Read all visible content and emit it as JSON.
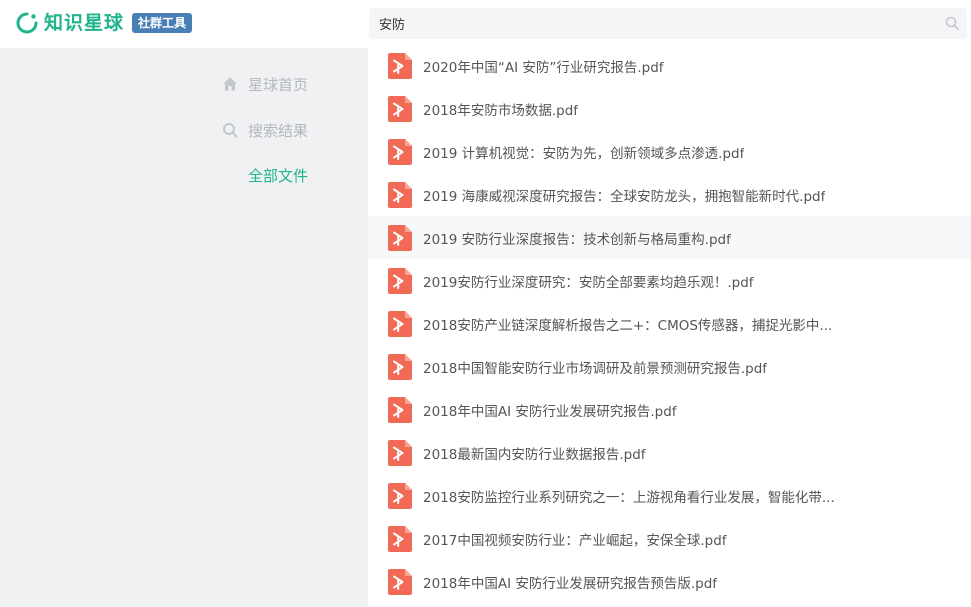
{
  "header": {
    "brand_name": "知识星球",
    "brand_badge": "社群工具",
    "accent_color": "#1fb38e",
    "badge_color": "#4a7fb5"
  },
  "search": {
    "value": "安防",
    "icon": "search-icon"
  },
  "sidebar": {
    "items": [
      {
        "label": "星球首页",
        "icon": "home-icon",
        "active": false
      },
      {
        "label": "搜索结果",
        "icon": "search-icon",
        "active": false
      },
      {
        "label": "全部文件",
        "icon": "",
        "active": true
      }
    ]
  },
  "files": {
    "icon": "pdf-file-icon",
    "icon_color": "#f06a55",
    "items": [
      {
        "name": "2020年中国“AI 安防”行业研究报告.pdf"
      },
      {
        "name": "2018年安防市场数据.pdf"
      },
      {
        "name": "2019 计算机视觉：安防为先，创新领域多点渗透.pdf"
      },
      {
        "name": "2019 海康威视深度研究报告：全球安防龙头，拥抱智能新时代.pdf"
      },
      {
        "name": "2019 安防行业深度报告：技术创新与格局重构.pdf"
      },
      {
        "name": "2019安防行业深度研究：安防全部要素均趋乐观！.pdf"
      },
      {
        "name": "2018安防产业链深度解析报告之二+：CMOS传感器，捕捉光影中..."
      },
      {
        "name": "2018中国智能安防行业市场调研及前景预测研究报告.pdf"
      },
      {
        "name": "2018年中国AI 安防行业发展研究报告.pdf"
      },
      {
        "name": "2018最新国内安防行业数据报告.pdf"
      },
      {
        "name": "2018安防监控行业系列研究之一：上游视角看行业发展，智能化带..."
      },
      {
        "name": "2017中国视频安防行业：产业崛起，安保全球.pdf"
      },
      {
        "name": "2018年中国AI 安防行业发展研究报告预告版.pdf"
      }
    ]
  }
}
